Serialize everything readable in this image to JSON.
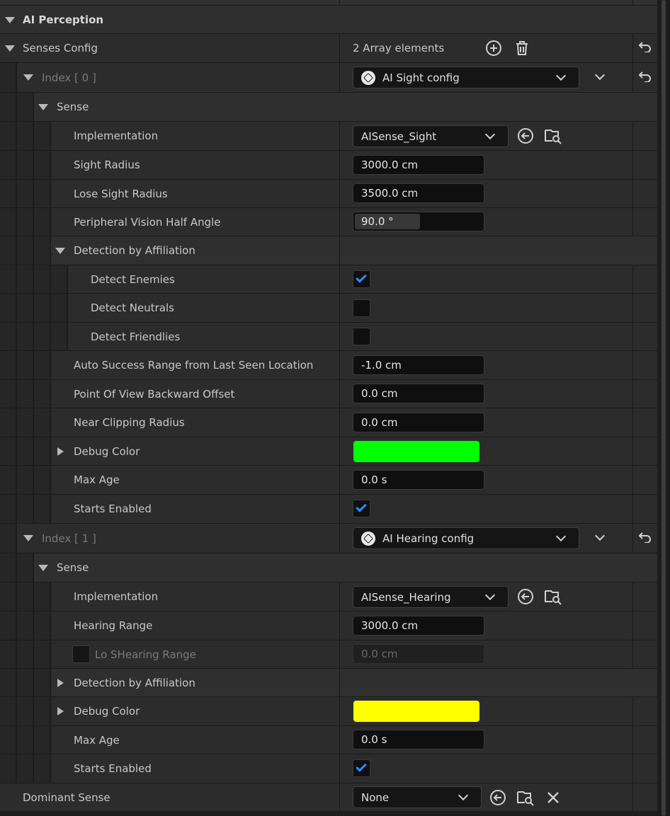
{
  "section": {
    "title": "AI Perception"
  },
  "senses_config": {
    "label": "Senses Config",
    "count": "2 Array elements"
  },
  "index0": {
    "label": "Index [ 0 ]",
    "config": "AI Sight config",
    "sense_label": "Sense",
    "implementation": {
      "label": "Implementation",
      "value": "AISense_Sight"
    },
    "sight_radius": {
      "label": "Sight Radius",
      "value": "3000.0 cm"
    },
    "lose_sight_radius": {
      "label": "Lose Sight Radius",
      "value": "3500.0 cm"
    },
    "peripheral": {
      "label": "Peripheral Vision Half Angle",
      "value": "90.0 °",
      "fraction": 0.5
    },
    "detection": {
      "label": "Detection by Affiliation",
      "enemies": {
        "label": "Detect Enemies",
        "checked": true
      },
      "neutrals": {
        "label": "Detect Neutrals",
        "checked": false
      },
      "friendlies": {
        "label": "Detect Friendlies",
        "checked": false
      }
    },
    "auto_success": {
      "label": "Auto Success Range from Last Seen Location",
      "value": "-1.0 cm"
    },
    "pov_offset": {
      "label": "Point Of View Backward Offset",
      "value": "0.0 cm"
    },
    "near_clip": {
      "label": "Near Clipping Radius",
      "value": "0.0 cm"
    },
    "debug_color": {
      "label": "Debug Color",
      "color": "#00ff00"
    },
    "max_age": {
      "label": "Max Age",
      "value": "0.0 s"
    },
    "starts_enabled": {
      "label": "Starts Enabled",
      "checked": true
    }
  },
  "index1": {
    "label": "Index [ 1 ]",
    "config": "AI Hearing config",
    "sense_label": "Sense",
    "implementation": {
      "label": "Implementation",
      "value": "AISense_Hearing"
    },
    "hearing_range": {
      "label": "Hearing Range",
      "value": "3000.0 cm"
    },
    "lo_hearing_range": {
      "label": "Lo SHearing Range",
      "value": "0.0 cm"
    },
    "detection": {
      "label": "Detection by Affiliation"
    },
    "debug_color": {
      "label": "Debug Color",
      "color": "#ffff00"
    },
    "max_age": {
      "label": "Max Age",
      "value": "0.0 s"
    },
    "starts_enabled": {
      "label": "Starts Enabled",
      "checked": true
    }
  },
  "dominant_sense": {
    "label": "Dominant Sense",
    "value": "None"
  }
}
